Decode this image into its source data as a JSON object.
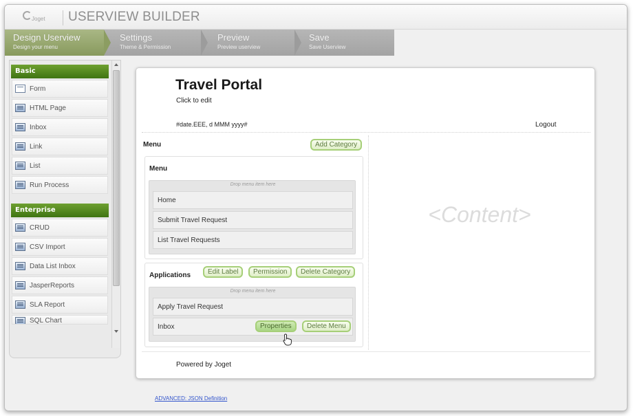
{
  "app": {
    "logo_text": "Joget",
    "title": "USERVIEW BUILDER"
  },
  "steps": [
    {
      "title": "Design Userview",
      "subtitle": "Design your menu",
      "active": true
    },
    {
      "title": "Settings",
      "subtitle": "Theme & Permission",
      "active": false
    },
    {
      "title": "Preview",
      "subtitle": "Preview userview",
      "active": false
    },
    {
      "title": "Save",
      "subtitle": "Save Userview",
      "active": false
    }
  ],
  "palette": {
    "basic_label": "Basic",
    "basic_items": [
      {
        "label": "Form",
        "icon": "form-icon"
      },
      {
        "label": "HTML Page",
        "icon": "html-page-icon"
      },
      {
        "label": "Inbox",
        "icon": "inbox-icon"
      },
      {
        "label": "Link",
        "icon": "link-icon"
      },
      {
        "label": "List",
        "icon": "list-icon"
      },
      {
        "label": "Run Process",
        "icon": "run-process-icon"
      }
    ],
    "enterprise_label": "Enterprise",
    "enterprise_items": [
      {
        "label": "CRUD",
        "icon": "crud-icon"
      },
      {
        "label": "CSV Import",
        "icon": "csv-import-icon"
      },
      {
        "label": "Data List Inbox",
        "icon": "data-list-inbox-icon"
      },
      {
        "label": "JasperReports",
        "icon": "jasperreports-icon"
      },
      {
        "label": "SLA Report",
        "icon": "sla-report-icon"
      },
      {
        "label": "SQL Chart",
        "icon": "sql-chart-icon"
      }
    ]
  },
  "userview": {
    "name": "Travel Portal",
    "description": "Click to edit",
    "date_format": "#date.EEE, d MMM yyyy#",
    "logout_label": "Logout",
    "menu_col_title": "Menu",
    "add_category_label": "Add Category",
    "drop_hint": "Drop menu item here",
    "categories": [
      {
        "label": "Menu",
        "items": [
          "Home",
          "Submit Travel Request",
          "List Travel Requests"
        ]
      },
      {
        "label": "Applications",
        "buttons": [
          "Edit Label",
          "Permission",
          "Delete Category"
        ],
        "items": [
          "Apply Travel Request",
          "Inbox"
        ],
        "item_buttons": [
          "Properties",
          "Delete Menu"
        ]
      }
    ],
    "content_placeholder": "<Content>",
    "footer": "Powered by Joget"
  },
  "advanced_link": "ADVANCED: JSON Definition"
}
